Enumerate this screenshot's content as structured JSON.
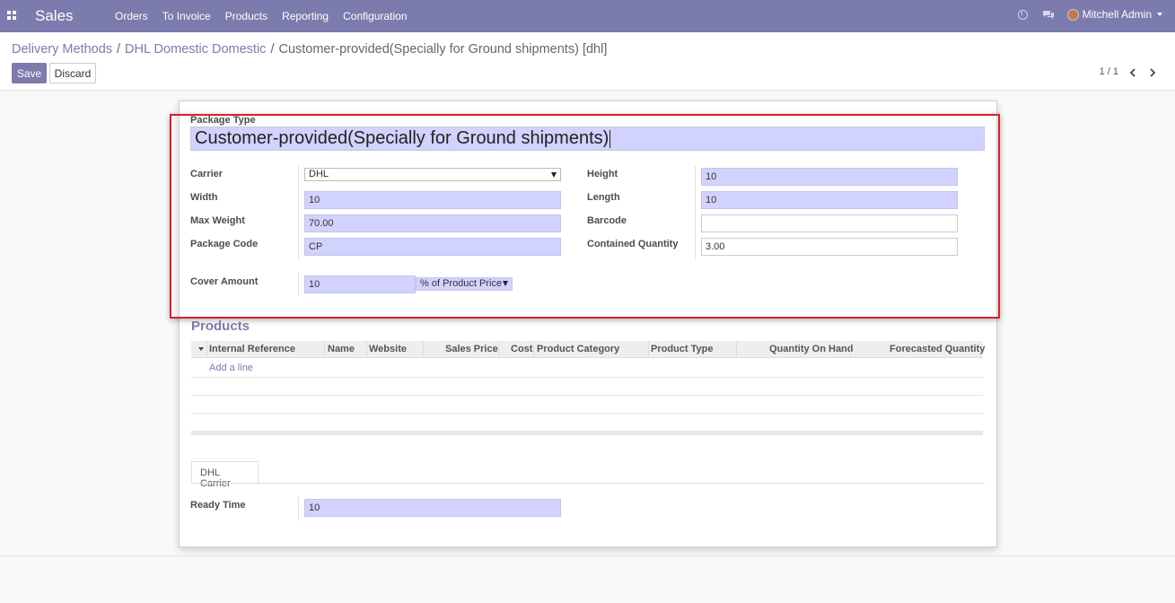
{
  "navbar": {
    "app_name": "Sales",
    "menu": [
      "Orders",
      "To Invoice",
      "Products",
      "Reporting",
      "Configuration"
    ],
    "user": "Mitchell Admin",
    "icons": [
      "apps-icon",
      "clock-icon",
      "chat-icon",
      "avatar"
    ]
  },
  "breadcrumb": {
    "items": [
      "Delivery Methods",
      "DHL Domestic Domestic"
    ],
    "current": "Customer-provided(Specially for Ground shipments) [dhl]"
  },
  "actions": {
    "save": "Save",
    "discard": "Discard"
  },
  "pager": {
    "text": "1 / 1"
  },
  "form": {
    "title_label": "Package Type",
    "title_value": "Customer-provided(Specially for Ground shipments)",
    "carrier": {
      "label": "Carrier",
      "value": "DHL"
    },
    "width": {
      "label": "Width",
      "value": "10"
    },
    "max_weight": {
      "label": "Max Weight",
      "value": "70.00"
    },
    "package_code": {
      "label": "Package Code",
      "value": "CP"
    },
    "height": {
      "label": "Height",
      "value": "10"
    },
    "length": {
      "label": "Length",
      "value": "10"
    },
    "barcode": {
      "label": "Barcode",
      "value": ""
    },
    "contained_quantity": {
      "label": "Contained Quantity",
      "value": "3.00"
    },
    "cover_amount": {
      "label": "Cover Amount",
      "value": "10",
      "unit": "% of Product Price"
    }
  },
  "products": {
    "title": "Products",
    "columns": [
      "Internal Reference",
      "Name",
      "Website",
      "Sales Price",
      "Cost",
      "Product Category",
      "Product Type",
      "Quantity On Hand",
      "Forecasted Quantity"
    ],
    "add_line": "Add a line"
  },
  "tabs": {
    "dhl_carrier": "DHL Carrier"
  },
  "dhl": {
    "ready_time": {
      "label": "Ready Time",
      "value": "10"
    }
  },
  "colors": {
    "brand": "#7c7bad",
    "input_bg": "#d2d2ff",
    "highlight": "#d9222a"
  }
}
